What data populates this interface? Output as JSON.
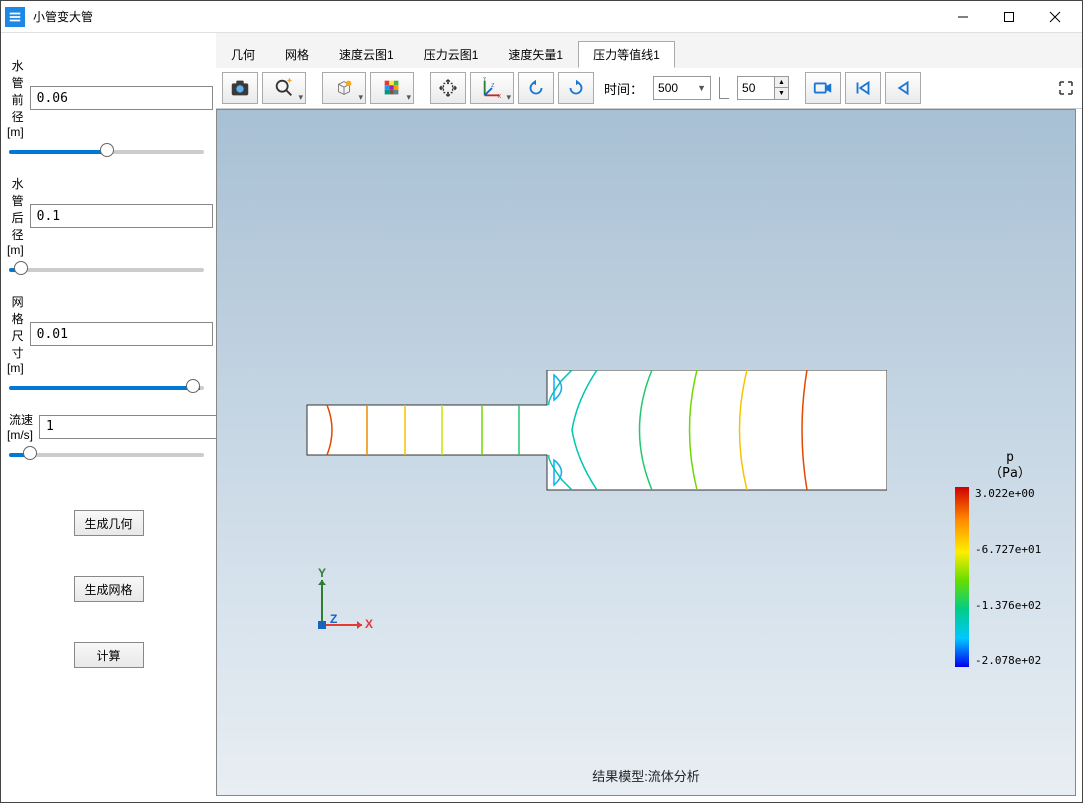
{
  "window": {
    "title": "小管变大管"
  },
  "params": {
    "pipe_front_diameter": {
      "label": "水管前径[m]",
      "value": "0.06",
      "slider": 50
    },
    "pipe_back_diameter": {
      "label": "水管后径[m]",
      "value": "0.1",
      "slider": 3
    },
    "mesh_size": {
      "label": "网格尺寸[m]",
      "value": "0.01",
      "slider": 98
    },
    "velocity": {
      "label": "流速[m/s]",
      "value": "1",
      "slider": 8
    }
  },
  "buttons": {
    "generate_geometry": "生成几何",
    "generate_mesh": "生成网格",
    "compute": "计算"
  },
  "tabs": {
    "items": [
      "几何",
      "网格",
      "速度云图1",
      "压力云图1",
      "速度矢量1",
      "压力等值线1"
    ],
    "active_index": 5
  },
  "toolbar": {
    "time_label": "时间：",
    "time_value": "500",
    "spin_value": "50"
  },
  "viewport": {
    "caption": "结果模型:流体分析",
    "axes": {
      "x": "X",
      "y": "Y",
      "z": "Z"
    }
  },
  "legend": {
    "title_line1": "p",
    "title_line2": "（Pa）",
    "ticks": [
      "3.022e+00",
      "-6.727e+01",
      "-1.376e+02",
      "-2.078e+02"
    ]
  },
  "chart_data": {
    "type": "contour",
    "description": "pressure contour lines inside a stepped pipe expansion",
    "variable": "p",
    "units": "Pa",
    "colormap_range": [
      -207.8,
      3.022
    ],
    "colormap": "rainbow",
    "geometry": {
      "inlet_height_m": 0.06,
      "outlet_height_m": 0.1,
      "kind": "sudden_expansion_2d"
    },
    "isoline_levels_approx": [
      -207.8,
      -172.6,
      -137.6,
      -102.5,
      -67.27,
      -32.2,
      3.022
    ],
    "time_step": 500
  }
}
